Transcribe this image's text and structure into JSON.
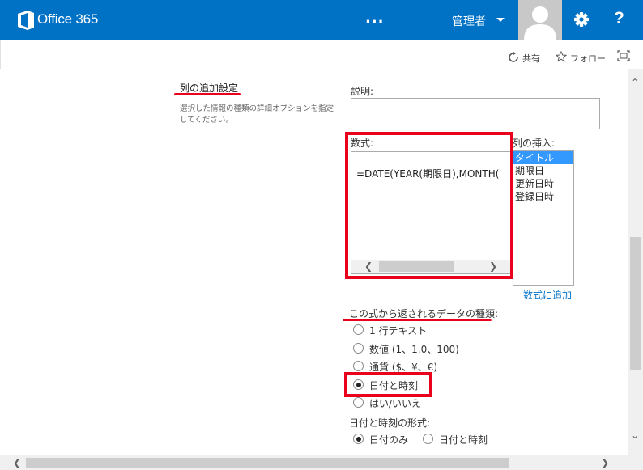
{
  "suite": {
    "app_name": "Office 365",
    "more_label": "...",
    "user_label": "管理者",
    "help_label": "?"
  },
  "actions": {
    "share_label": "共有",
    "follow_label": "フォロー"
  },
  "section": {
    "title": "列の追加設定",
    "description": "選択した情報の種類の詳細オプションを指定してください。"
  },
  "description_field": {
    "label": "説明:",
    "value": ""
  },
  "formula_field": {
    "label": "数式:",
    "value": "=DATE(YEAR(期限日),MONTH("
  },
  "insert_column": {
    "label": "列の挿入:",
    "items": [
      "タイトル",
      "期限日",
      "更新日時",
      "登録日時"
    ],
    "selected_index": 0,
    "add_link": "数式に追加"
  },
  "return_type": {
    "label": "この式から返されるデータの種類:",
    "options": [
      "1 行テキスト",
      "数値 (1、1.0、100)",
      "通貨 ($、¥、€)",
      "日付と時刻",
      "はい/いいえ"
    ],
    "selected": "日付と時刻"
  },
  "date_format": {
    "label": "日付と時刻の形式:",
    "options": [
      "日付のみ",
      "日付と時刻"
    ],
    "selected": "日付のみ"
  },
  "colors": {
    "suite_bar": "#0072c6",
    "highlight": "#e8001c",
    "link": "#0072c6",
    "list_selected": "#3399ff"
  }
}
